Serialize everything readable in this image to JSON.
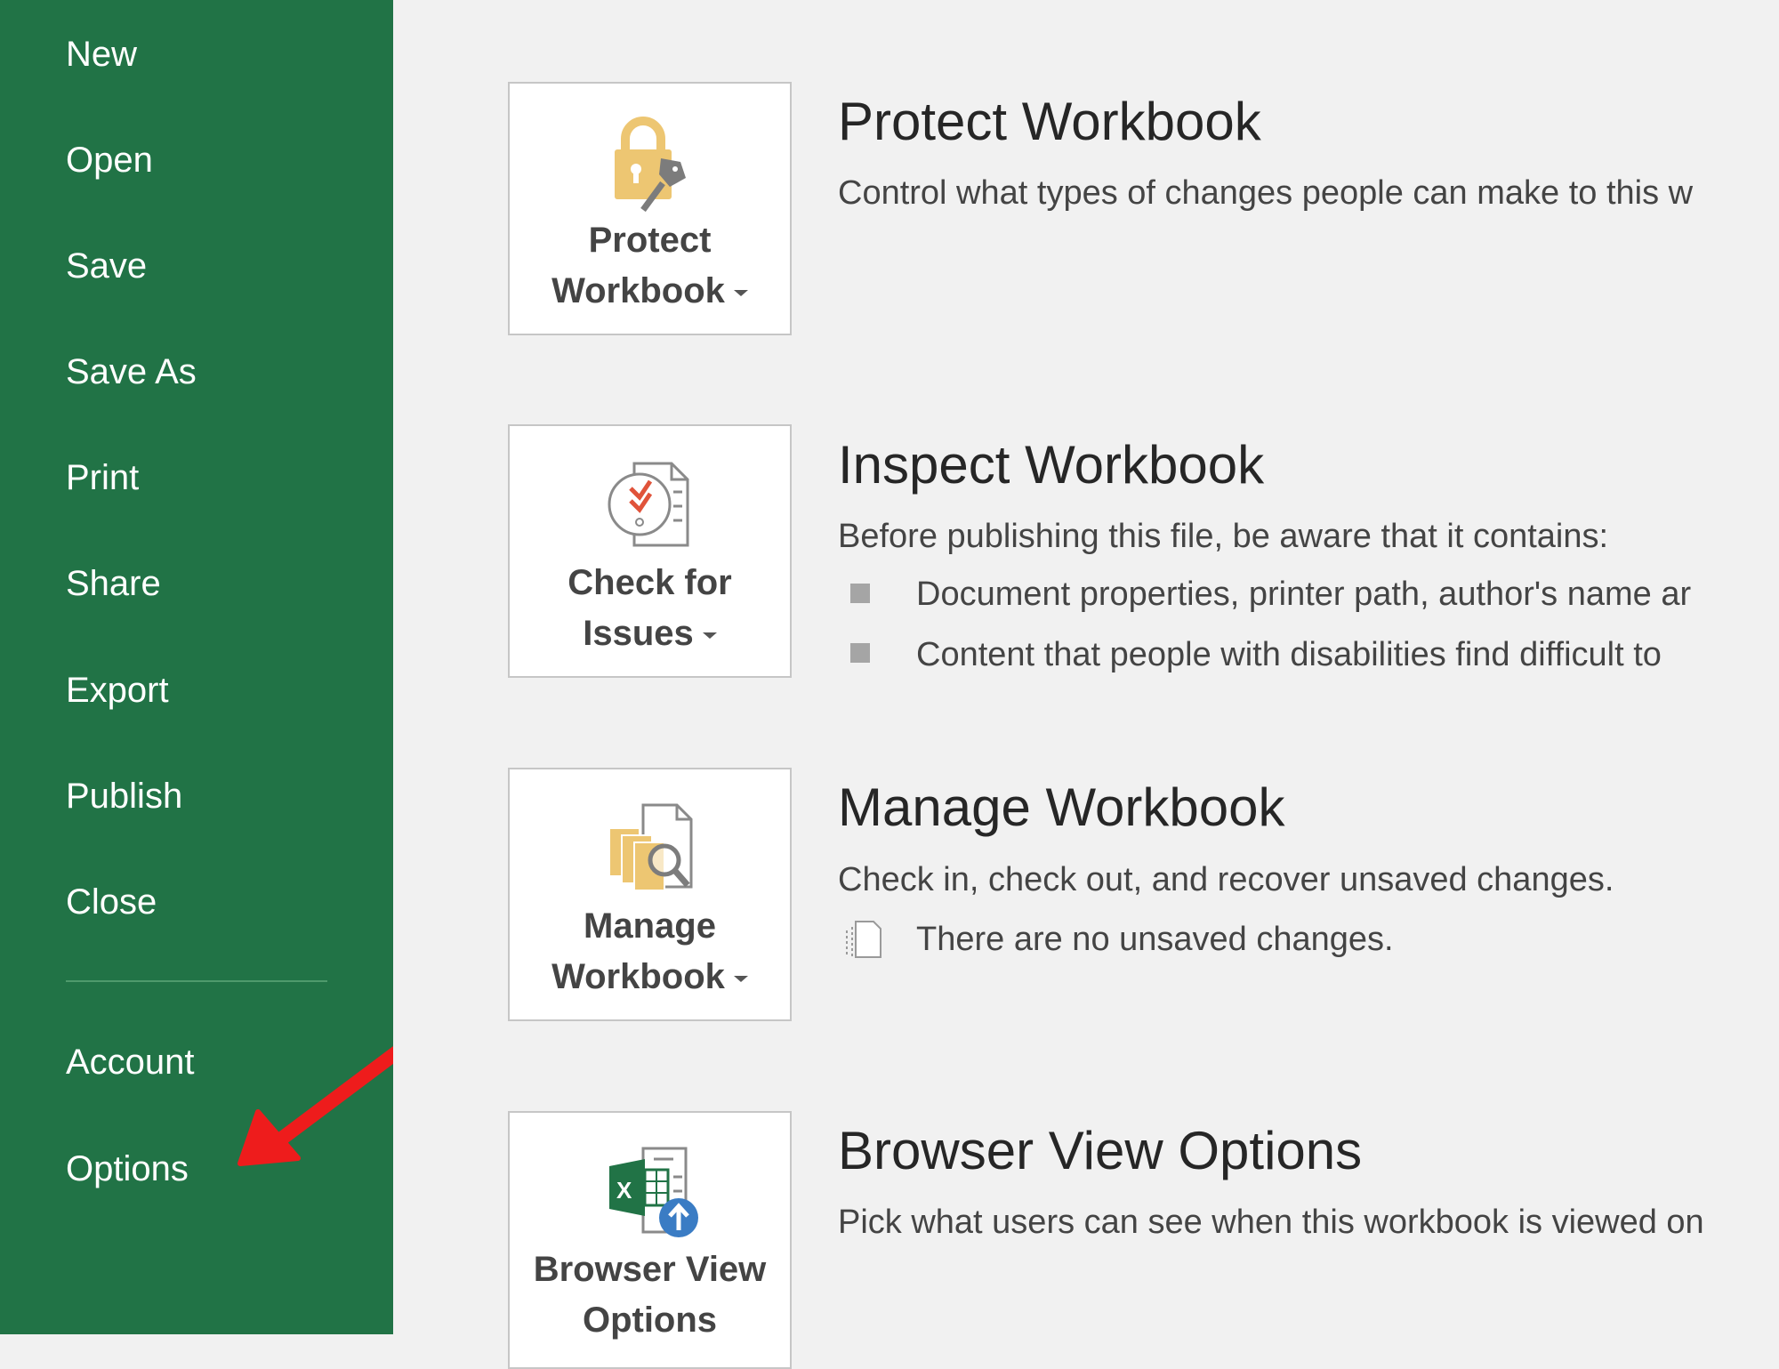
{
  "sidebar": {
    "items": [
      {
        "label": "New"
      },
      {
        "label": "Open"
      },
      {
        "label": "Save"
      },
      {
        "label": "Save As"
      },
      {
        "label": "Print"
      },
      {
        "label": "Share"
      },
      {
        "label": "Export"
      },
      {
        "label": "Publish"
      },
      {
        "label": "Close"
      }
    ],
    "bottom_items": [
      {
        "label": "Account"
      },
      {
        "label": "Options"
      }
    ],
    "background_color": "#217346"
  },
  "sections": [
    {
      "button_line1": "Protect",
      "button_line2": "Workbook",
      "icon": "lock-key-icon",
      "title": "Protect Workbook",
      "description": "Control what types of changes people can make to this w"
    },
    {
      "button_line1": "Check for",
      "button_line2": "Issues",
      "icon": "inspect-document-icon",
      "title": "Inspect Workbook",
      "description": "Before publishing this file, be aware that it contains:",
      "bullets": [
        "Document properties, printer path, author's name ar",
        "Content that people with disabilities find difficult to"
      ]
    },
    {
      "button_line1": "Manage",
      "button_line2": "Workbook",
      "icon": "manage-versions-icon",
      "title": "Manage Workbook",
      "description": "Check in, check out, and recover unsaved changes.",
      "note": "There are no unsaved changes."
    },
    {
      "button_line1": "Browser View",
      "button_line2": "Options",
      "icon": "excel-browser-view-icon",
      "title": "Browser View Options",
      "description": "Pick what users can see when this workbook is viewed on"
    }
  ],
  "annotation": {
    "type": "red-arrow",
    "points_to": "Options",
    "color": "#ee1c1c"
  }
}
